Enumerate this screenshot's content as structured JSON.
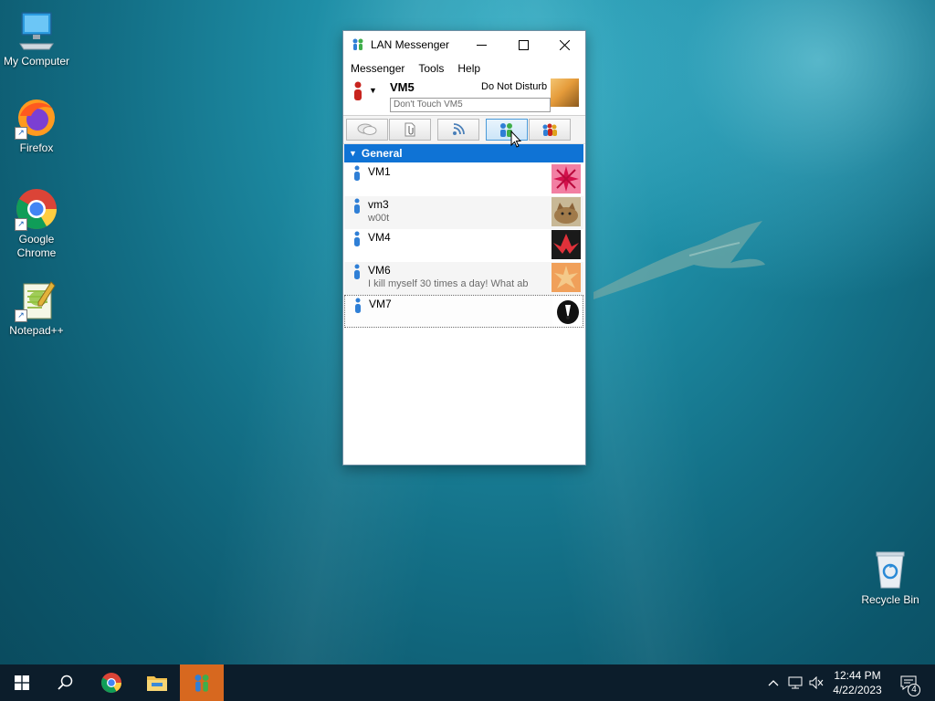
{
  "desktop": {
    "icons": [
      {
        "label": "My Computer",
        "icon": "computer-icon"
      },
      {
        "label": "Firefox",
        "icon": "firefox-icon"
      },
      {
        "label": "Google Chrome",
        "icon": "chrome-icon"
      },
      {
        "label": "Notepad++",
        "icon": "notepadpp-icon"
      },
      {
        "label": "Recycle Bin",
        "icon": "recycle-bin-icon"
      }
    ]
  },
  "window": {
    "title": "LAN Messenger",
    "menu": [
      "Messenger",
      "Tools",
      "Help"
    ],
    "profile": {
      "name": "VM5",
      "status": "Do Not Disturb",
      "note_value": "Don't Touch VM5"
    },
    "toolbar": [
      {
        "name": "chat-icon"
      },
      {
        "name": "file-transfer-icon"
      },
      {
        "name": "broadcast-icon"
      },
      {
        "name": "add-contact-icon"
      },
      {
        "name": "groups-icon"
      }
    ],
    "group": {
      "label": "General"
    },
    "users": [
      {
        "name": "VM1",
        "note": ""
      },
      {
        "name": "vm3",
        "note": "w00t"
      },
      {
        "name": "VM4",
        "note": ""
      },
      {
        "name": "VM6",
        "note": "I kill myself 30 times a day! What ab..."
      },
      {
        "name": "VM7",
        "note": ""
      }
    ]
  },
  "taskbar": {
    "time": "12:44 PM",
    "date": "4/22/2023",
    "notification_count": "4"
  },
  "colors": {
    "accent_blue": "#0f73d5",
    "taskbar_bg": "#0c1d2b",
    "active_taskbar_item": "#d7681f"
  }
}
